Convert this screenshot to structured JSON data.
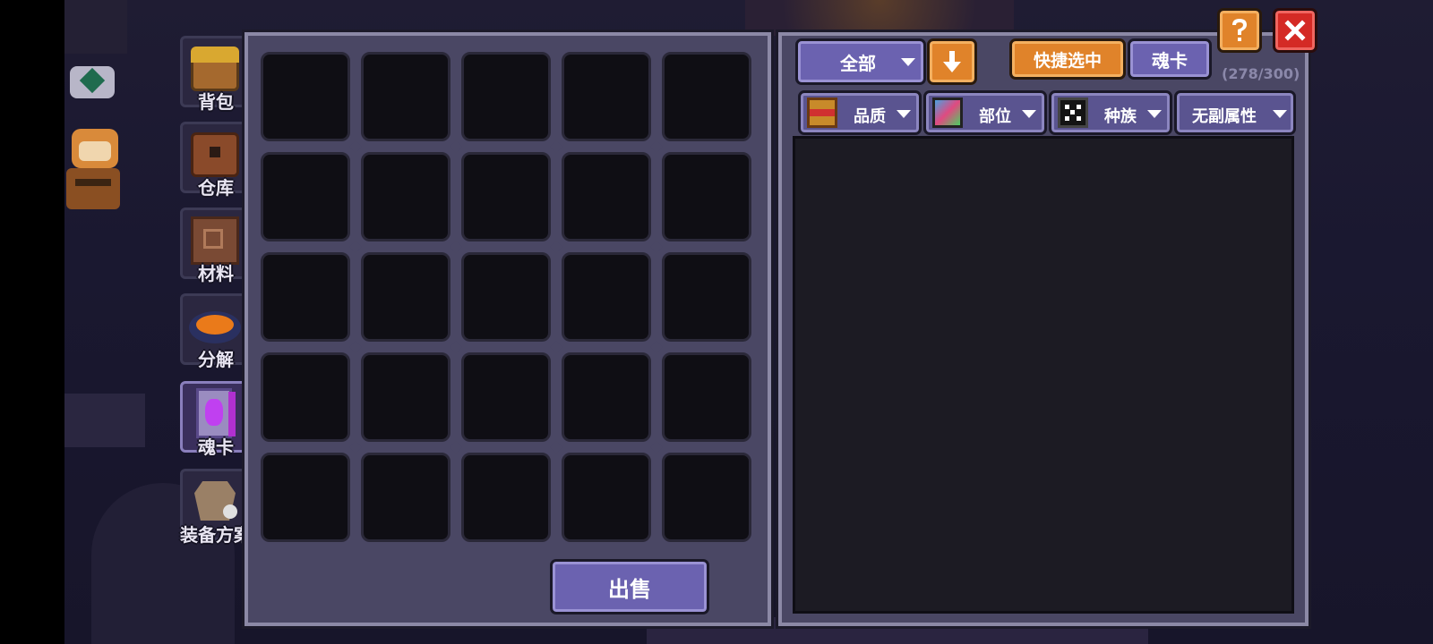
{
  "sidebar": {
    "items": [
      {
        "label": "背包",
        "icon": "backpack-chest-icon"
      },
      {
        "label": "仓库",
        "icon": "warehouse-chest-icon"
      },
      {
        "label": "材料",
        "icon": "materials-book-icon"
      },
      {
        "label": "分解",
        "icon": "disassemble-cauldron-icon"
      },
      {
        "label": "魂卡",
        "icon": "soul-card-icon",
        "active": true
      },
      {
        "label": "装备方案",
        "icon": "equipment-preset-icon"
      }
    ]
  },
  "inventory": {
    "rows": 5,
    "cols": 5,
    "sell_label": "出售"
  },
  "toolbar": {
    "category_label": "全部",
    "quick_select_label": "快捷选中",
    "soul_card_label": "魂卡",
    "capacity": "(278/300)"
  },
  "filters": [
    {
      "label": "品质",
      "icon": "quality-book-icon"
    },
    {
      "label": "部位",
      "icon": "slot-gradient-icon"
    },
    {
      "label": "种族",
      "icon": "race-dice-icon"
    },
    {
      "label": "无副属性",
      "icon": ""
    }
  ],
  "colors": {
    "panel": "#4a4764",
    "accent_orange": "#e0832a",
    "accent_purple": "#6b62b0",
    "close_red": "#d42a25"
  }
}
